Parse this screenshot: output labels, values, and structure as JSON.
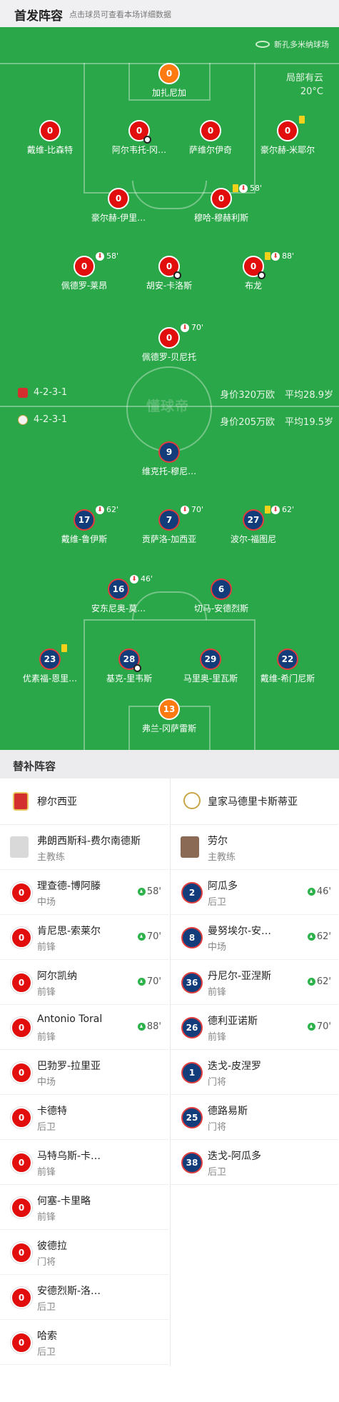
{
  "header": {
    "title": "首发阵容",
    "hint": "点击球员可查看本场详细数据"
  },
  "venue": {
    "stadium": "新孔多米纳球场",
    "weather": "局部有云",
    "temperature": "20°C"
  },
  "home": {
    "formation": "4-2-3-1",
    "value": "身价320万欧",
    "avg_age": "平均28.9岁",
    "players": [
      {
        "num": "0",
        "name": "加扎尼加",
        "gk": true
      },
      {
        "num": "0",
        "name": "戴维-比森特"
      },
      {
        "num": "0",
        "name": "阿尔韦托-冈…",
        "goal": true
      },
      {
        "num": "0",
        "name": "萨维尔伊奇"
      },
      {
        "num": "0",
        "name": "豪尔赫-米耶尔",
        "card": true
      },
      {
        "num": "0",
        "name": "豪尔赫-伊里…"
      },
      {
        "num": "0",
        "name": "穆哈-穆赫利斯",
        "card": true,
        "sub_min": "58'"
      },
      {
        "num": "0",
        "name": "佩德罗-莱昂",
        "sub_min": "58'"
      },
      {
        "num": "0",
        "name": "胡安-卡洛斯",
        "goal": true
      },
      {
        "num": "0",
        "name": "布龙",
        "card": true,
        "sub_min": "88'",
        "goal": true
      },
      {
        "num": "0",
        "name": "佩德罗-贝尼托",
        "sub_min": "70'"
      }
    ]
  },
  "away": {
    "formation": "4-2-3-1",
    "value": "身价205万欧",
    "avg_age": "平均19.5岁",
    "players": [
      {
        "num": "9",
        "name": "维克托-穆尼…"
      },
      {
        "num": "17",
        "name": "戴维-鲁伊斯",
        "sub_min": "62'"
      },
      {
        "num": "7",
        "name": "贡萨洛-加西亚",
        "sub_min": "70'"
      },
      {
        "num": "27",
        "name": "波尔-福图尼",
        "card": true,
        "sub_min": "62'"
      },
      {
        "num": "16",
        "name": "安东尼奥-莫…",
        "sub_min": "46'"
      },
      {
        "num": "6",
        "name": "切马-安德烈斯"
      },
      {
        "num": "23",
        "name": "优素福-恩里…",
        "card": true
      },
      {
        "num": "28",
        "name": "基克-里韦斯",
        "goal": true
      },
      {
        "num": "29",
        "name": "马里奥-里瓦斯"
      },
      {
        "num": "22",
        "name": "戴维-希门尼斯"
      },
      {
        "num": "13",
        "name": "弗兰-冈萨雷斯",
        "gk": true
      }
    ]
  },
  "watermark": "懂球帝",
  "subs": {
    "title": "替补阵容",
    "home_team": "穆尔西亚",
    "away_team": "皇家马德里卡斯蒂亚",
    "home_coach": {
      "name": "弗朗西斯科-费尔南德斯",
      "role": "主教练"
    },
    "away_coach": {
      "name": "劳尔",
      "role": "主教练"
    },
    "home": [
      {
        "num": "0",
        "name": "理查德-博阿滕",
        "pos": "中场",
        "min": "58'"
      },
      {
        "num": "0",
        "name": "肯尼思-索莱尔",
        "pos": "前锋",
        "min": "70'"
      },
      {
        "num": "0",
        "name": "阿尔凯纳",
        "pos": "前锋",
        "min": "70'"
      },
      {
        "num": "0",
        "name": "Antonio Toral",
        "pos": "前锋",
        "min": "88'"
      },
      {
        "num": "0",
        "name": "巴勃罗-拉里亚",
        "pos": "中场",
        "min": ""
      },
      {
        "num": "0",
        "name": "卡德特",
        "pos": "后卫",
        "min": ""
      },
      {
        "num": "0",
        "name": "马特乌斯-卡…",
        "pos": "前锋",
        "min": ""
      },
      {
        "num": "0",
        "name": "何塞-卡里略",
        "pos": "前锋",
        "min": ""
      },
      {
        "num": "0",
        "name": "彼德拉",
        "pos": "门将",
        "min": ""
      },
      {
        "num": "0",
        "name": "安德烈斯-洛…",
        "pos": "后卫",
        "min": ""
      },
      {
        "num": "0",
        "name": "哈索",
        "pos": "后卫",
        "min": ""
      }
    ],
    "away": [
      {
        "num": "2",
        "name": "阿瓜多",
        "pos": "后卫",
        "min": "46'"
      },
      {
        "num": "8",
        "name": "曼努埃尔-安…",
        "pos": "中场",
        "min": "62'"
      },
      {
        "num": "36",
        "name": "丹尼尔-亚涅斯",
        "pos": "前锋",
        "min": "62'"
      },
      {
        "num": "26",
        "name": "德利亚诺斯",
        "pos": "前锋",
        "min": "70'"
      },
      {
        "num": "1",
        "name": "迭戈-皮涅罗",
        "pos": "门将",
        "min": ""
      },
      {
        "num": "25",
        "name": "德路易斯",
        "pos": "门将",
        "min": ""
      },
      {
        "num": "38",
        "name": "迭戈-阿瓜多",
        "pos": "后卫",
        "min": ""
      }
    ]
  },
  "colors": {
    "pitch": "#2aa748",
    "home_dot": "#e20e0e",
    "away_dot": "#123d7a",
    "gk_dot": "#ff7a11"
  }
}
